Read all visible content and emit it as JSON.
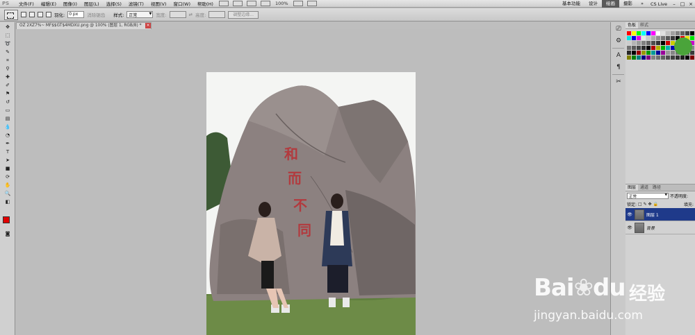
{
  "menubar": {
    "logo": "PS",
    "items": [
      "文件(F)",
      "编辑(E)",
      "图像(I)",
      "图层(L)",
      "选择(S)",
      "滤镜(T)",
      "视图(V)",
      "窗口(W)",
      "帮助(H)"
    ],
    "zoom": "100%",
    "workspaces": [
      "基本功能",
      "设计",
      "绘画",
      "摄影"
    ],
    "active_workspace": "绘画",
    "more": "»",
    "cslive": "CS Live"
  },
  "options": {
    "feather_label": "羽化:",
    "feather_value": "0 px",
    "antialias_label": "消除锯齿",
    "style_label": "样式:",
    "style_value": "正常",
    "width_label": "宽度:",
    "height_label": "高度:",
    "refine_button": "调整边缘..."
  },
  "document": {
    "tab_title": "OZ 2XZ7%~ MF$$GT$4MDXU.png @ 100% (图层 1, RGB/8) *",
    "close": "×"
  },
  "right_panel": {
    "swatch_tabs": [
      "色板",
      "样式"
    ],
    "layer_tabs": [
      "图层",
      "通道",
      "路径"
    ],
    "blend_mode": "正常",
    "opacity_label": "不透明度:",
    "lock_label": "锁定:",
    "fill_label": "填充:",
    "layers": [
      {
        "name": "图层 1",
        "selected": true
      },
      {
        "name": "背景",
        "selected": false
      }
    ]
  },
  "image": {
    "rock_text": "和而不同"
  },
  "watermark": {
    "brand": "Bai",
    "brand2": "du",
    "cn": "经验",
    "url": "jingyan.baidu.com"
  },
  "colors": {
    "foreground": "#e00000",
    "background": "#ffffff",
    "selected_layer": "#1f3a8a"
  }
}
